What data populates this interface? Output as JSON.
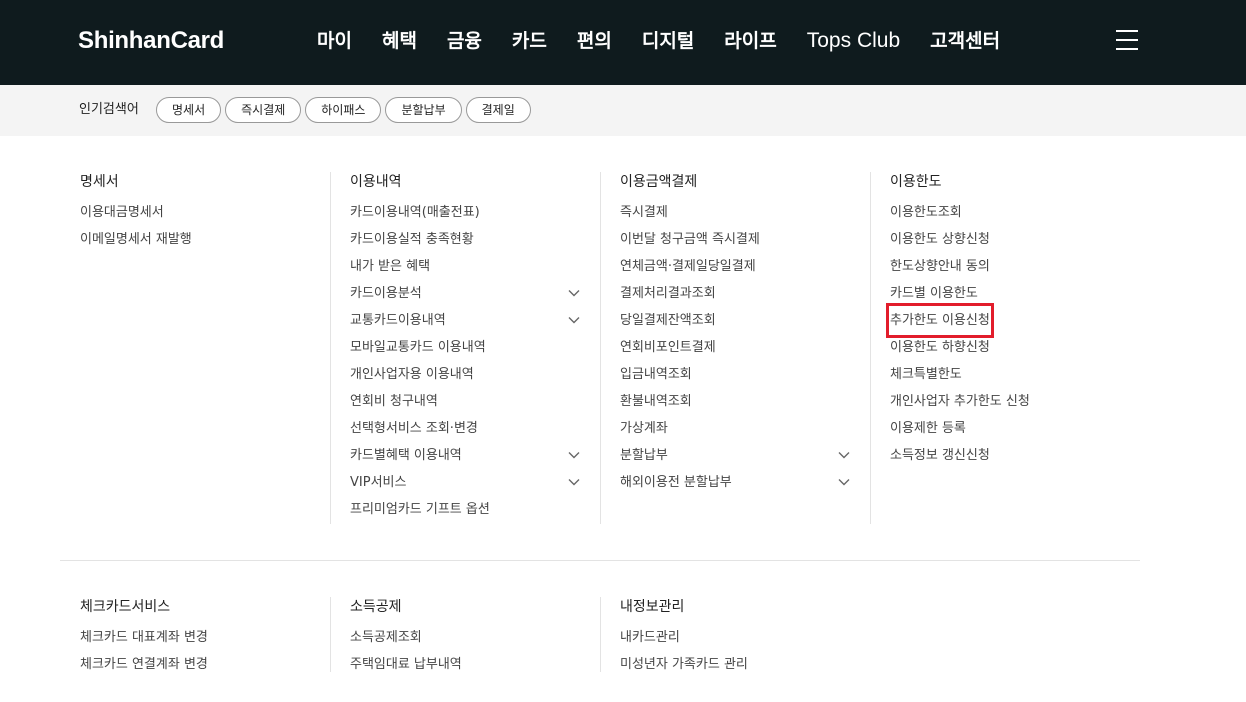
{
  "header": {
    "logo": "ShinhanCard",
    "nav": [
      "마이",
      "혜택",
      "금융",
      "카드",
      "편의",
      "디지털",
      "라이프",
      "Tops Club",
      "고객센터"
    ]
  },
  "popular": {
    "label": "인기검색어",
    "chips": [
      "명세서",
      "즉시결제",
      "하이패스",
      "분할납부",
      "결제일"
    ]
  },
  "columns": [
    {
      "title": "명세서",
      "items": [
        {
          "label": "이용대금명세서",
          "expand": false
        },
        {
          "label": "이메일명세서 재발행",
          "expand": false
        }
      ]
    },
    {
      "title": "이용내역",
      "items": [
        {
          "label": "카드이용내역(매출전표)",
          "expand": false
        },
        {
          "label": "카드이용실적 충족현황",
          "expand": false
        },
        {
          "label": "내가 받은 혜택",
          "expand": false
        },
        {
          "label": "카드이용분석",
          "expand": true
        },
        {
          "label": "교통카드이용내역",
          "expand": true
        },
        {
          "label": "모바일교통카드 이용내역",
          "expand": false
        },
        {
          "label": "개인사업자용 이용내역",
          "expand": false
        },
        {
          "label": "연회비 청구내역",
          "expand": false
        },
        {
          "label": "선택형서비스 조회·변경",
          "expand": false
        },
        {
          "label": "카드별혜택 이용내역",
          "expand": true
        },
        {
          "label": "VIP서비스",
          "expand": true
        },
        {
          "label": "프리미엄카드 기프트 옵션",
          "expand": false
        }
      ]
    },
    {
      "title": "이용금액결제",
      "items": [
        {
          "label": "즉시결제",
          "expand": false
        },
        {
          "label": "이번달 청구금액 즉시결제",
          "expand": false
        },
        {
          "label": "연체금액·결제일당일결제",
          "expand": false
        },
        {
          "label": "결제처리결과조회",
          "expand": false
        },
        {
          "label": "당일결제잔액조회",
          "expand": false
        },
        {
          "label": "연회비포인트결제",
          "expand": false
        },
        {
          "label": "입금내역조회",
          "expand": false
        },
        {
          "label": "환불내역조회",
          "expand": false
        },
        {
          "label": "가상계좌",
          "expand": false
        },
        {
          "label": "분할납부",
          "expand": true
        },
        {
          "label": "해외이용전 분할납부",
          "expand": true
        }
      ]
    },
    {
      "title": "이용한도",
      "items": [
        {
          "label": "이용한도조회",
          "expand": false
        },
        {
          "label": "이용한도 상향신청",
          "expand": false
        },
        {
          "label": "한도상향안내 동의",
          "expand": false
        },
        {
          "label": "카드별 이용한도",
          "expand": false
        },
        {
          "label": "추가한도 이용신청",
          "expand": false,
          "highlighted": true
        },
        {
          "label": "이용한도 하향신청",
          "expand": false
        },
        {
          "label": "체크특별한도",
          "expand": false
        },
        {
          "label": "개인사업자 추가한도 신청",
          "expand": false
        },
        {
          "label": "이용제한 등록",
          "expand": false
        },
        {
          "label": "소득정보 갱신신청",
          "expand": false
        }
      ]
    }
  ],
  "columns_row2": [
    {
      "title": "체크카드서비스",
      "items": [
        {
          "label": "체크카드 대표계좌 변경",
          "expand": false
        },
        {
          "label": "체크카드 연결계좌 변경",
          "expand": false
        }
      ]
    },
    {
      "title": "소득공제",
      "items": [
        {
          "label": "소득공제조회",
          "expand": false
        },
        {
          "label": "주택임대료 납부내역",
          "expand": false
        }
      ]
    },
    {
      "title": "내정보관리",
      "items": [
        {
          "label": "내카드관리",
          "expand": false
        },
        {
          "label": "미성년자 가족카드 관리",
          "expand": false
        }
      ]
    }
  ],
  "colors": {
    "header_bg": "#0f1b1e",
    "popular_bg": "#f4f4f4",
    "highlight": "#e21d2b"
  }
}
